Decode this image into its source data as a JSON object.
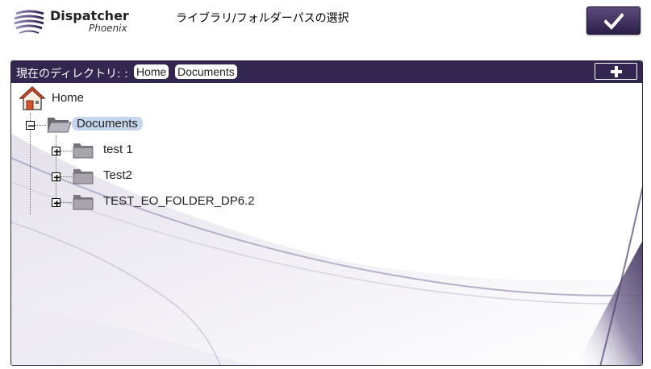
{
  "app": {
    "logo_main": "Dispatcher",
    "logo_sub": "Phoenix",
    "title": "ライブラリ/フォルダーパスの選択"
  },
  "path_bar": {
    "label": "現在のディレクトリ: :",
    "breadcrumbs": [
      "Home",
      "Documents"
    ]
  },
  "tree": {
    "root": "Home",
    "selected": "Documents",
    "children": [
      "test 1",
      "Test2",
      "TEST_EO_FOLDER_DP6.2"
    ]
  },
  "colors": {
    "accent": "#332650",
    "selection": "#c5d6ec"
  },
  "icons": {
    "confirm": "checkmark-icon",
    "add": "plus-icon",
    "root": "home-icon",
    "folder": "folder-icon"
  }
}
